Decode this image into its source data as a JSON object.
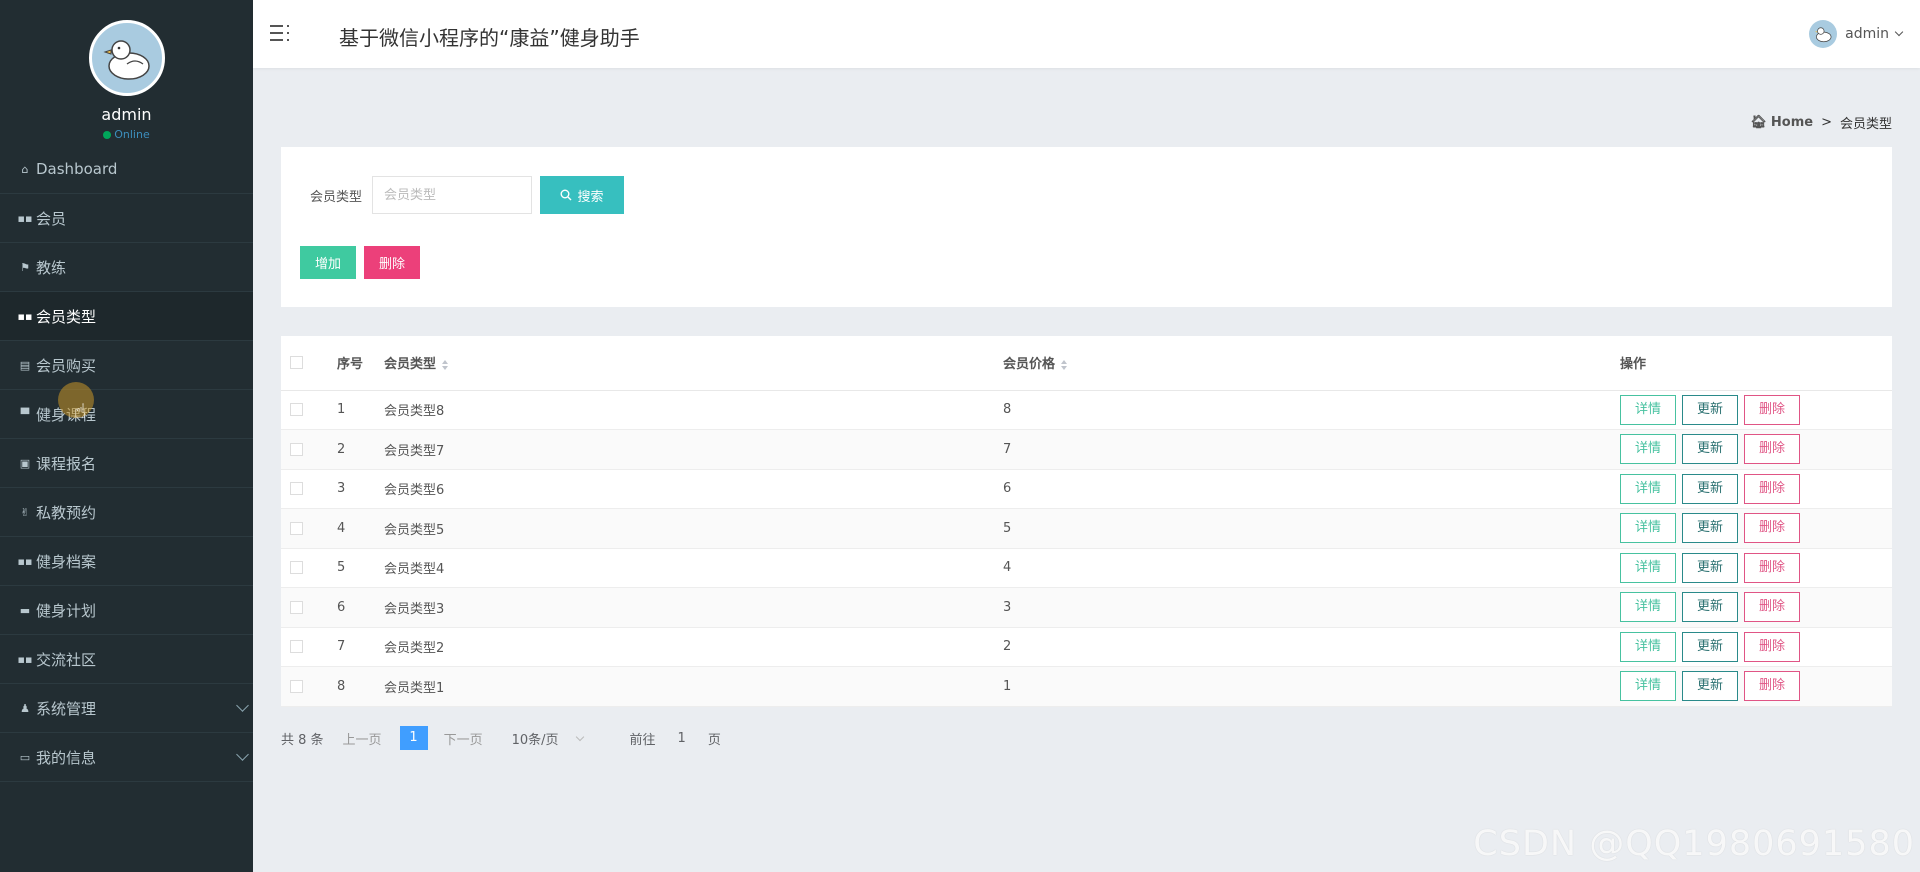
{
  "sidebar": {
    "username": "admin",
    "status": "Online",
    "items": [
      {
        "label": "Dashboard",
        "icon": "home-icon"
      },
      {
        "label": "会员",
        "icon": "grid-icon"
      },
      {
        "label": "教练",
        "icon": "flag-icon"
      },
      {
        "label": "会员类型",
        "icon": "grid-icon",
        "active": true
      },
      {
        "label": "会员购买",
        "icon": "clipboard-icon"
      },
      {
        "label": "健身课程",
        "icon": "monitor-icon"
      },
      {
        "label": "课程报名",
        "icon": "calendar-icon"
      },
      {
        "label": "私教预约",
        "icon": "thumbs-up-icon"
      },
      {
        "label": "健身档案",
        "icon": "grid-icon"
      },
      {
        "label": "健身计划",
        "icon": "briefcase-icon"
      },
      {
        "label": "交流社区",
        "icon": "grid-icon"
      },
      {
        "label": "系统管理",
        "icon": "user-icon",
        "expandable": true
      },
      {
        "label": "我的信息",
        "icon": "card-icon",
        "expandable": true
      }
    ]
  },
  "header": {
    "title": "基于微信小程序的“康益”健身助手",
    "user": "admin"
  },
  "breadcrumb": {
    "home": "Home",
    "separator": ">",
    "current": "会员类型"
  },
  "search": {
    "label": "会员类型",
    "placeholder": "会员类型",
    "button": "搜索",
    "add": "增加",
    "delete": "删除"
  },
  "table": {
    "headers": {
      "id": "序号",
      "type": "会员类型",
      "price": "会员价格",
      "ops": "操作"
    },
    "rows": [
      {
        "id": "1",
        "type": "会员类型8",
        "price": "8"
      },
      {
        "id": "2",
        "type": "会员类型7",
        "price": "7"
      },
      {
        "id": "3",
        "type": "会员类型6",
        "price": "6"
      },
      {
        "id": "4",
        "type": "会员类型5",
        "price": "5"
      },
      {
        "id": "5",
        "type": "会员类型4",
        "price": "4"
      },
      {
        "id": "6",
        "type": "会员类型3",
        "price": "3"
      },
      {
        "id": "7",
        "type": "会员类型2",
        "price": "2"
      },
      {
        "id": "8",
        "type": "会员类型1",
        "price": "1"
      }
    ],
    "ops": {
      "detail": "详情",
      "update": "更新",
      "delete": "删除"
    }
  },
  "pager": {
    "total": "共 8 条",
    "prev": "上一页",
    "current": "1",
    "next": "下一页",
    "size": "10条/页",
    "goto": "前往",
    "goto_value": "1",
    "page_unit": "页"
  },
  "watermark": "CSDN @QQ1980691580",
  "colors": {
    "sidebar": "#222d32",
    "search_button": "#37bfbf",
    "add_button": "#3fcaa0",
    "delete_button": "#ec407a",
    "pager_active": "#409eff"
  }
}
